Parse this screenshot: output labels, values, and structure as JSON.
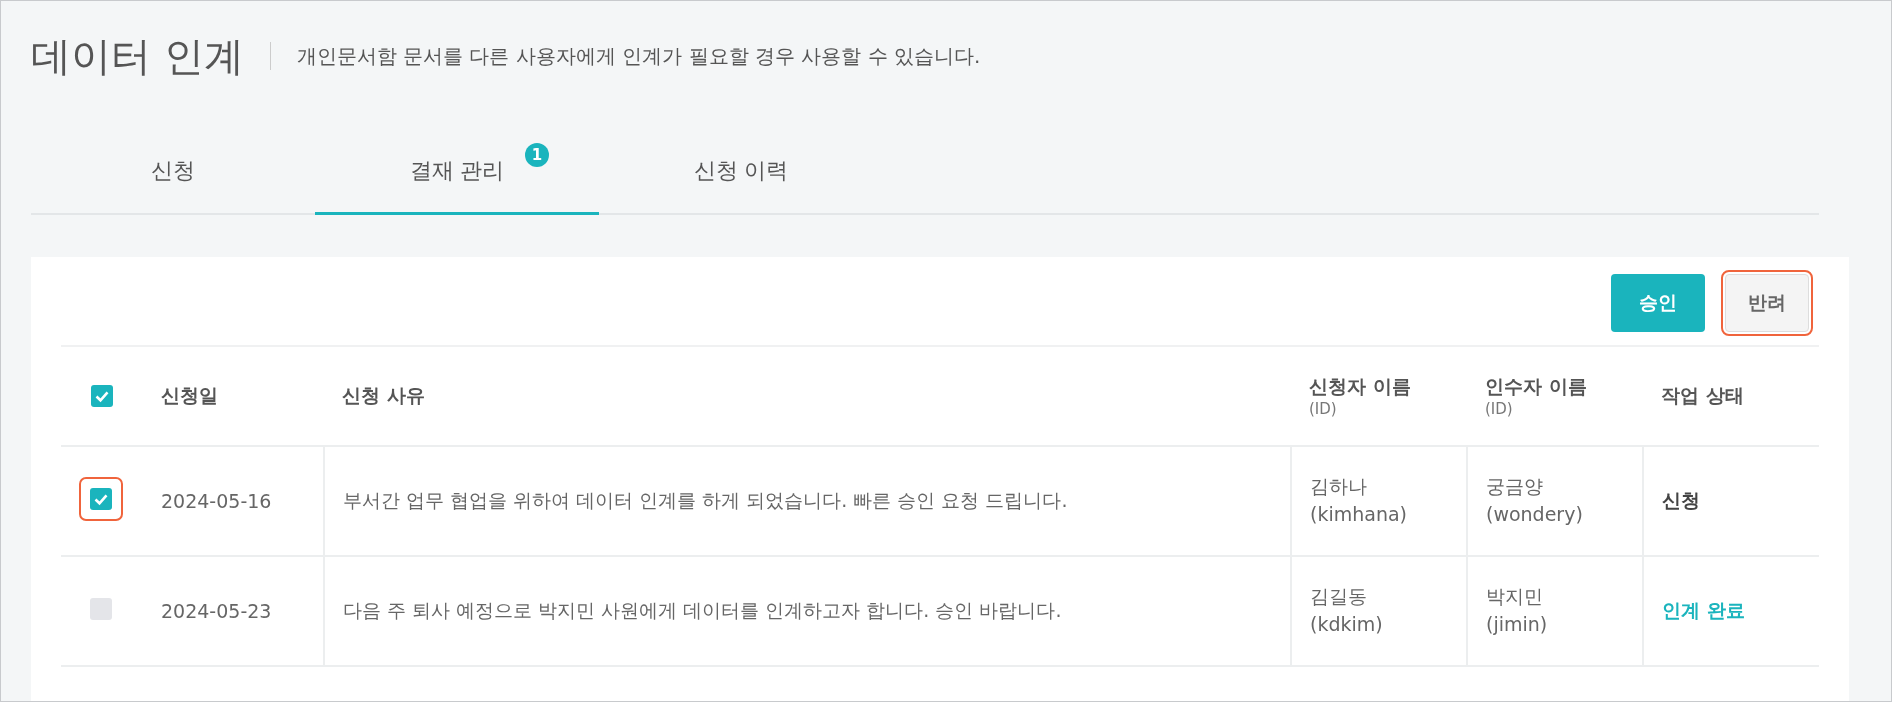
{
  "header": {
    "title": "데이터 인계",
    "description": "개인문서함 문서를 다른 사용자에게 인계가 필요할 경우 사용할 수 있습니다."
  },
  "tabs": [
    {
      "label": "신청",
      "selected": false
    },
    {
      "label": "결재 관리",
      "selected": true,
      "badge": "1"
    },
    {
      "label": "신청 이력",
      "selected": false
    }
  ],
  "actions": [
    {
      "label": "승인",
      "kind": "primary",
      "highlighted": false
    },
    {
      "label": "반려",
      "kind": "secondary",
      "highlighted": true
    }
  ],
  "table": {
    "select_all": {
      "checked": true
    },
    "columns": [
      {
        "label": "신청일"
      },
      {
        "label": "신청 사유"
      },
      {
        "label": "신청자 이름",
        "sub": "(ID)"
      },
      {
        "label": "인수자 이름",
        "sub": "(ID)"
      },
      {
        "label": "작업 상태"
      }
    ],
    "rows": [
      {
        "checked": true,
        "highlighted": true,
        "date": "2024-05-16",
        "reason": "부서간 업무 협업을 위하여 데이터 인계를 하게 되었습니다. 빠른 승인 요청 드립니다.",
        "applicant": "김하나",
        "applicant_id": "(kimhana)",
        "receiver": "궁금양",
        "receiver_id": "(wondery)",
        "status": "신청",
        "kind": "requested"
      },
      {
        "checked": false,
        "highlighted": false,
        "date": "2024-05-23",
        "reason": "다음 주 퇴사 예정으로 박지민 사원에게 데이터를 인계하고자 합니다. 승인 바랍니다.",
        "applicant": "김길동",
        "applicant_id": "(kdkim)",
        "receiver": "박지민",
        "receiver_id": "(jimin)",
        "status": "인계 완료",
        "kind": "done"
      }
    ]
  }
}
